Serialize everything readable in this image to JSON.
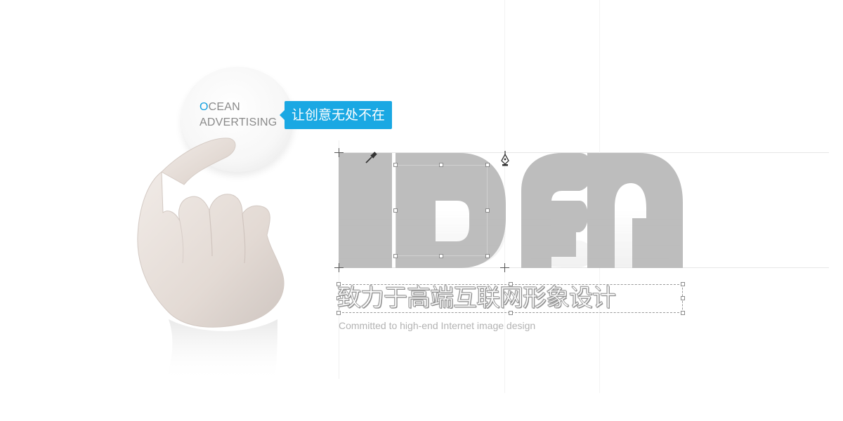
{
  "brand": {
    "accent_letter": "O",
    "line1_rest": "CEAN",
    "line2": "ADVERTISING",
    "accent_color": "#14a0e0"
  },
  "bubble": {
    "text": "让创意无处不在",
    "color": "#1aa8e3"
  },
  "hero": {
    "word": "IDEA",
    "letter_color": "#bdbdbd"
  },
  "slogan": {
    "cn": "致力于高端互联网形象设计",
    "en": "Committed to high-end Internet image design"
  },
  "icons": [
    "eyedropper-icon",
    "pen-tool-icon",
    "crosshair-icon"
  ]
}
